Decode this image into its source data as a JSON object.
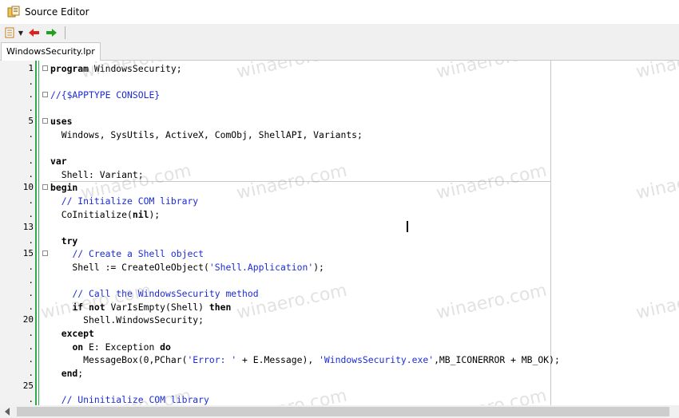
{
  "window": {
    "title": "Source Editor",
    "icon": "source-editor-icon"
  },
  "toolbar": {
    "buttons": [
      "jump-list-icon",
      "back-arrow-icon",
      "forward-arrow-icon"
    ]
  },
  "tabs": [
    {
      "label": "WindowsSecurity.lpr"
    }
  ],
  "editor": {
    "lines": [
      {
        "num": "1",
        "fold": true,
        "tokens": [
          [
            "kw",
            "program"
          ],
          [
            "t",
            " WindowsSecurity;"
          ]
        ]
      },
      {
        "num": ".",
        "fold": false,
        "tokens": []
      },
      {
        "num": ".",
        "fold": true,
        "tokens": [
          [
            "cm",
            "//{$APPTYPE CONSOLE}"
          ]
        ]
      },
      {
        "num": ".",
        "fold": false,
        "tokens": []
      },
      {
        "num": "5",
        "fold": true,
        "tokens": [
          [
            "kw",
            "uses"
          ]
        ]
      },
      {
        "num": ".",
        "fold": false,
        "tokens": [
          [
            "t",
            "  Windows, SysUtils, ActiveX, ComObj, ShellAPI, Variants;"
          ]
        ]
      },
      {
        "num": ".",
        "fold": false,
        "tokens": []
      },
      {
        "num": ".",
        "fold": false,
        "tokens": [
          [
            "kw",
            "var"
          ]
        ]
      },
      {
        "num": ".",
        "fold": false,
        "tokens": [
          [
            "t",
            "  Shell: Variant;"
          ]
        ]
      },
      {
        "num": "10",
        "fold": true,
        "tokens": [
          [
            "kw",
            "begin"
          ]
        ]
      },
      {
        "num": ".",
        "fold": false,
        "tokens": [
          [
            "t",
            "  "
          ],
          [
            "cm",
            "// Initialize COM library"
          ]
        ]
      },
      {
        "num": ".",
        "fold": false,
        "tokens": [
          [
            "t",
            "  CoInitialize("
          ],
          [
            "kw",
            "nil"
          ],
          [
            "t",
            ");"
          ]
        ]
      },
      {
        "num": "13",
        "fold": false,
        "tokens": []
      },
      {
        "num": ".",
        "fold": false,
        "tokens": [
          [
            "t",
            "  "
          ],
          [
            "kw",
            "try"
          ]
        ]
      },
      {
        "num": "15",
        "fold": true,
        "tokens": [
          [
            "t",
            "    "
          ],
          [
            "cm",
            "// Create a Shell object"
          ]
        ]
      },
      {
        "num": ".",
        "fold": false,
        "tokens": [
          [
            "t",
            "    Shell := CreateOleObject("
          ],
          [
            "str",
            "'Shell.Application'"
          ],
          [
            "t",
            ");"
          ]
        ]
      },
      {
        "num": ".",
        "fold": false,
        "tokens": []
      },
      {
        "num": ".",
        "fold": false,
        "tokens": [
          [
            "t",
            "    "
          ],
          [
            "cm",
            "// Call the WindowsSecurity method"
          ]
        ]
      },
      {
        "num": ".",
        "fold": false,
        "tokens": [
          [
            "t",
            "    "
          ],
          [
            "kw",
            "if not"
          ],
          [
            "t",
            " VarIsEmpty(Shell) "
          ],
          [
            "kw",
            "then"
          ]
        ]
      },
      {
        "num": "20",
        "fold": false,
        "tokens": [
          [
            "t",
            "      Shell.WindowsSecurity;"
          ]
        ]
      },
      {
        "num": ".",
        "fold": false,
        "tokens": [
          [
            "t",
            "  "
          ],
          [
            "kw",
            "except"
          ]
        ]
      },
      {
        "num": ".",
        "fold": false,
        "tokens": [
          [
            "t",
            "    "
          ],
          [
            "kw",
            "on"
          ],
          [
            "t",
            " E: Exception "
          ],
          [
            "kw",
            "do"
          ]
        ]
      },
      {
        "num": ".",
        "fold": false,
        "tokens": [
          [
            "t",
            "      MessageBox(0,PChar("
          ],
          [
            "str",
            "'Error: '"
          ],
          [
            "t",
            " + E.Message), "
          ],
          [
            "str",
            "'WindowsSecurity.exe'"
          ],
          [
            "t",
            ",MB_ICONERROR + MB_OK);"
          ]
        ]
      },
      {
        "num": ".",
        "fold": false,
        "tokens": [
          [
            "t",
            "  "
          ],
          [
            "kw",
            "end"
          ],
          [
            "t",
            ";"
          ]
        ]
      },
      {
        "num": "25",
        "fold": false,
        "tokens": []
      },
      {
        "num": ".",
        "fold": false,
        "tokens": [
          [
            "t",
            "  "
          ],
          [
            "cm",
            "// Uninitialize COM library"
          ]
        ]
      }
    ]
  },
  "watermark_text": "winaero.com",
  "colors": {
    "gutter_marker": "#2fa84f",
    "comment": "#1b2cd6",
    "string": "#1b2cd6"
  }
}
